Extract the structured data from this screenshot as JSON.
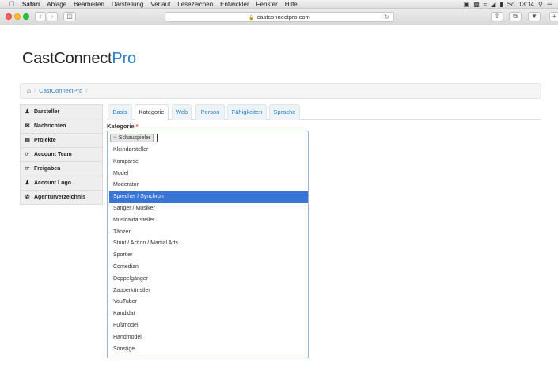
{
  "menubar": {
    "app": "Safari",
    "items": [
      "Ablage",
      "Bearbeiten",
      "Darstellung",
      "Verlauf",
      "Lesezeichen",
      "Entwickler",
      "Fenster",
      "Hilfe"
    ],
    "clock": "So. 13:14"
  },
  "browser": {
    "url": "castconnectpro.com"
  },
  "logo": {
    "part1": "CastConnect",
    "part2": "Pro"
  },
  "breadcrumb": {
    "separator": "/",
    "link": "CastConnectPro"
  },
  "sidebar": {
    "items": [
      {
        "label": "Darsteller",
        "icon": "user-icon"
      },
      {
        "label": "Nachrichten",
        "icon": "envelope-icon"
      },
      {
        "label": "Projekte",
        "icon": "list-icon"
      },
      {
        "label": "Account Team",
        "icon": "hand-point-icon"
      },
      {
        "label": "Freigaben",
        "icon": "hand-point-icon"
      },
      {
        "label": "Account Logo",
        "icon": "user-icon"
      },
      {
        "label": "Agenturverzeichnis",
        "icon": "phone-icon"
      }
    ]
  },
  "tabs": [
    {
      "label": "Basis"
    },
    {
      "label": "Kategorie"
    },
    {
      "label": "Web"
    },
    {
      "label": "Person"
    },
    {
      "label": "Fähigkeiten"
    },
    {
      "label": "Sprache"
    }
  ],
  "form": {
    "label": "Kategorie",
    "required_mark": "*",
    "selected_tag": "Schauspieler",
    "tag_remove": "×",
    "highlighted": "Sprecher / Synchron",
    "options": [
      "Kleindarsteller",
      "Komparse",
      "Model",
      "Moderator",
      "Sprecher / Synchron",
      "Sänger / Musiker",
      "Musicaldarsteller",
      "Tänzer",
      "Stunt / Action / Martial Arts",
      "Sportler",
      "Comedian",
      "Doppelgänger",
      "Zauberkünstler",
      "YouTuber",
      "Kandidat",
      "Fußmodel",
      "Handmodel",
      "Sonstige"
    ]
  },
  "colors": {
    "accent": "#2b7fc3",
    "highlight": "#3875d7",
    "required": "#d9534f"
  }
}
